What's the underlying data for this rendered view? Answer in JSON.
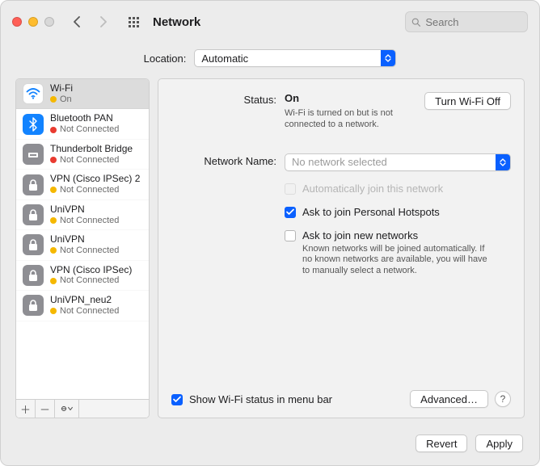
{
  "toolbar": {
    "title": "Network",
    "search_placeholder": "Search"
  },
  "location": {
    "label": "Location:",
    "value": "Automatic"
  },
  "services": [
    {
      "name": "Wi-Fi",
      "status": "On",
      "dot": "yellow",
      "icon": "wifi",
      "selected": true
    },
    {
      "name": "Bluetooth PAN",
      "status": "Not Connected",
      "dot": "red",
      "icon": "bluetooth"
    },
    {
      "name": "Thunderbolt Bridge",
      "status": "Not Connected",
      "dot": "red",
      "icon": "thunderbolt"
    },
    {
      "name": "VPN (Cisco IPSec) 2",
      "status": "Not Connected",
      "dot": "yellow",
      "icon": "lock"
    },
    {
      "name": "UniVPN",
      "status": "Not Connected",
      "dot": "yellow",
      "icon": "lock"
    },
    {
      "name": "UniVPN",
      "status": "Not Connected",
      "dot": "yellow",
      "icon": "lock"
    },
    {
      "name": "VPN (Cisco IPSec)",
      "status": "Not Connected",
      "dot": "yellow",
      "icon": "lock"
    },
    {
      "name": "UniVPN_neu2",
      "status": "Not Connected",
      "dot": "yellow",
      "icon": "lock"
    }
  ],
  "detail": {
    "status_label": "Status:",
    "status_value": "On",
    "turn_off_label": "Turn Wi-Fi Off",
    "status_desc": "Wi-Fi is turned on but is not connected to a network.",
    "network_name_label": "Network Name:",
    "network_name_value": "No network selected",
    "auto_join_label": "Automatically join this network",
    "ask_hotspot_label": "Ask to join Personal Hotspots",
    "ask_new_label": "Ask to join new networks",
    "ask_new_desc": "Known networks will be joined automatically. If no known networks are available, you will have to manually select a network.",
    "show_status_label": "Show Wi-Fi status in menu bar",
    "advanced_label": "Advanced…"
  },
  "buttons": {
    "revert": "Revert",
    "apply": "Apply",
    "help": "?"
  }
}
